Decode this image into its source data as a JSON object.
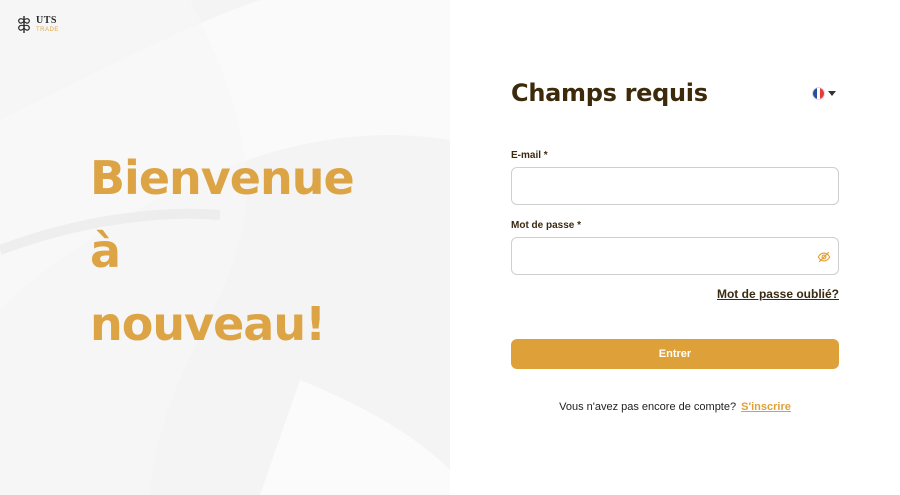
{
  "brand": {
    "title": "UTS",
    "subtitle": "TRADE"
  },
  "welcome": {
    "line1": "Bienvenue",
    "line2": "à",
    "line3": "nouveau!"
  },
  "form": {
    "title": "Champs requis",
    "language": {
      "selected": "fr",
      "icon": "flag-france-icon"
    },
    "email": {
      "label": "E-mail *",
      "value": "",
      "placeholder": ""
    },
    "password": {
      "label": "Mot de passe *",
      "value": "",
      "placeholder": "",
      "toggle_icon": "eye-slash-icon"
    },
    "forgot_label": "Mot de passe oublié?",
    "submit_label": "Entrer",
    "signup_prompt": "Vous n'avez pas encore de compte?",
    "signup_link": "S'inscrire"
  },
  "colors": {
    "accent": "#dea13a",
    "heading": "#dca445",
    "dark_brown": "#3c2a0a",
    "left_bg": "#f4f4f4"
  }
}
